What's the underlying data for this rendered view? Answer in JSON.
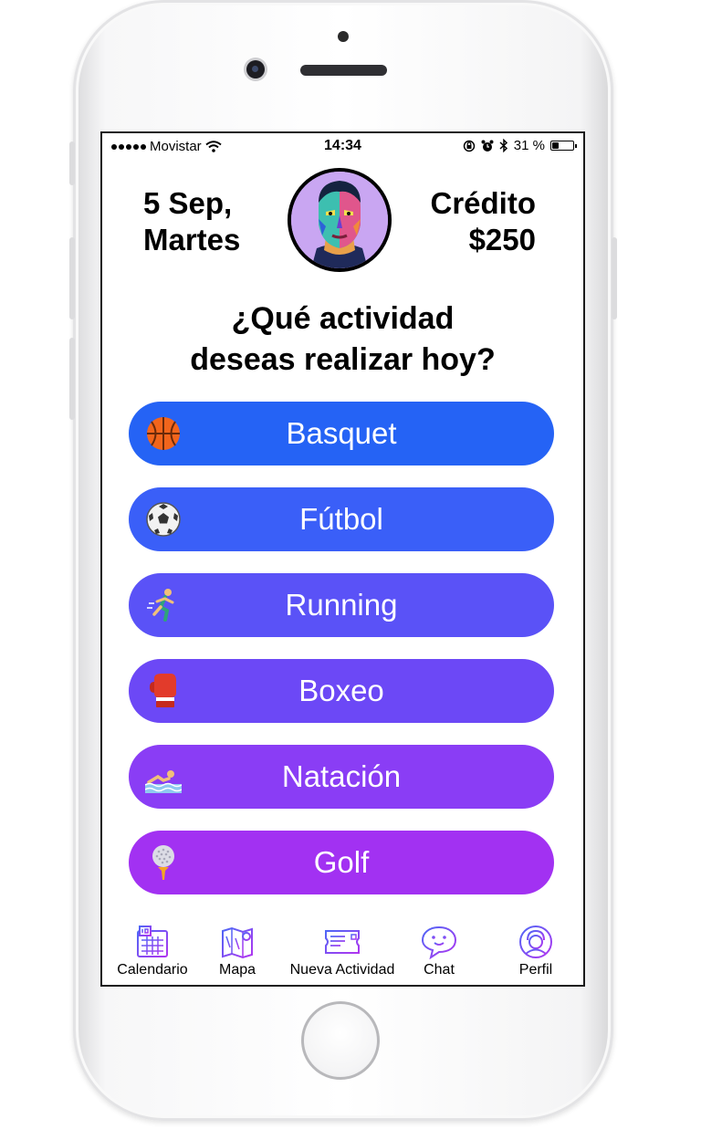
{
  "status_bar": {
    "carrier": "Movistar",
    "time": "14:34",
    "battery": "31 %",
    "battery_level": 0.31
  },
  "header": {
    "date_line1": "5 Sep,",
    "date_line2": "Martes",
    "credit_label": "Crédito",
    "credit_value": "$250"
  },
  "question": {
    "line1": "¿Qué actividad",
    "line2": "deseas realizar hoy?"
  },
  "activities": [
    {
      "label": "Basquet",
      "icon": "basketball-icon",
      "color": "#2563f5"
    },
    {
      "label": "Fútbol",
      "icon": "soccer-ball-icon",
      "color": "#3a5ff8"
    },
    {
      "label": "Running",
      "icon": "runner-icon",
      "color": "#5a52f7"
    },
    {
      "label": "Boxeo",
      "icon": "boxing-glove-icon",
      "color": "#6c48f6"
    },
    {
      "label": "Natación",
      "icon": "swimmer-icon",
      "color": "#8a3df5"
    },
    {
      "label": "Golf",
      "icon": "golf-ball-icon",
      "color": "#a231f2"
    }
  ],
  "tabbar": [
    {
      "label": "Calendario",
      "icon": "calendar-icon"
    },
    {
      "label": "Mapa",
      "icon": "map-icon"
    },
    {
      "label": "Nueva Actividad",
      "icon": "ticket-icon"
    },
    {
      "label": "Chat",
      "icon": "chat-bubble-icon"
    },
    {
      "label": "Perfil",
      "icon": "profile-icon"
    }
  ],
  "colors": {
    "tab_icon_gradient_start": "#4e67f6",
    "tab_icon_gradient_end": "#b035f0"
  }
}
